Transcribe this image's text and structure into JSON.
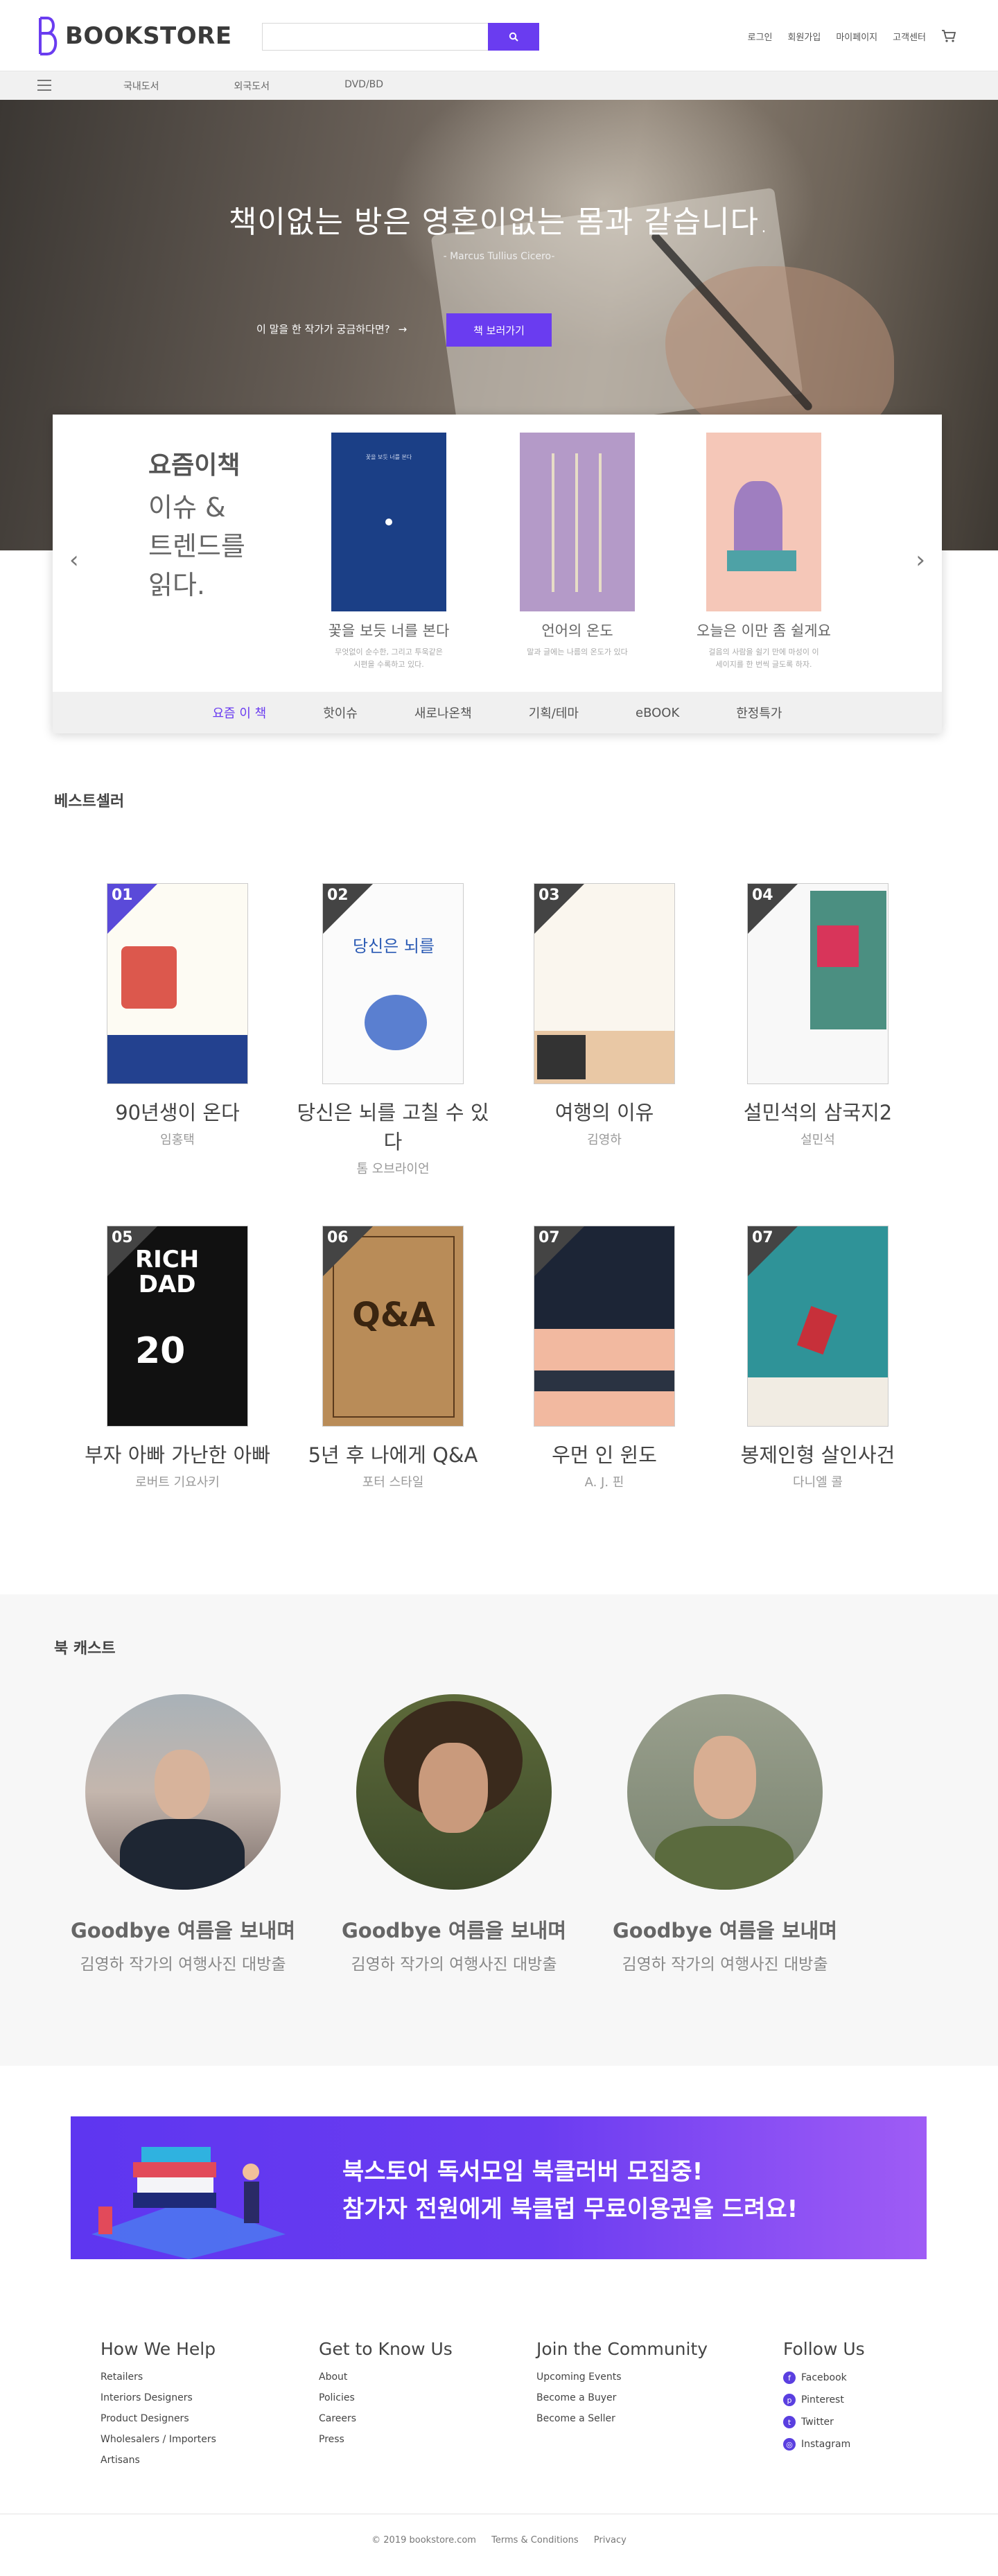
{
  "header": {
    "logo_text": "BOOKSTORE",
    "search_placeholder": "",
    "links": [
      "로그인",
      "회원가입",
      "마이페이지",
      "고객센터"
    ]
  },
  "categories": [
    "국내도서",
    "외국도서",
    "DVD/BD"
  ],
  "hero": {
    "title": "책이없는 방은 영혼이없는 몸과 같습니다.",
    "subtitle": "- Marcus Tullius Cicero-",
    "question": "이 말을 한 작가가 궁금하다면?",
    "button": "책 보러가기"
  },
  "recent": {
    "heading": "요즘이책",
    "subheading": [
      "이슈 &",
      "트렌드를",
      "읽다."
    ],
    "books": [
      {
        "title": "꽃을 보듯 너를 본다",
        "desc": "무엇없이 순수한, 그리고 투욱같은\n시편을 수록하고 있다."
      },
      {
        "title": "언어의 온도",
        "desc": "말과 글에는 나름의 온도가 있다"
      },
      {
        "title": "오늘은 이만 좀 쉴게요",
        "desc": "걸음의 사람을 쉴기 만에 마성이 이\n 세이지를 한 번씩 글도록 하자."
      }
    ],
    "tabs": [
      "요즘 이 책",
      "핫이슈",
      "새로나온책",
      "기획/테마",
      "eBOOK",
      "한정특가"
    ]
  },
  "bestseller": {
    "title": "베스트셀러",
    "books": [
      {
        "rank": "01",
        "title": "90년생이 온다",
        "author": "임홍택"
      },
      {
        "rank": "02",
        "title": "당신은 뇌를 고칠 수 있다",
        "author": "톰 오브라이언"
      },
      {
        "rank": "03",
        "title": "여행의 이유",
        "author": "김영하"
      },
      {
        "rank": "04",
        "title": "설민석의 삼국지2",
        "author": "설민석"
      },
      {
        "rank": "05",
        "title": "부자 아빠 가난한 아빠",
        "author": "로버트 기요사키"
      },
      {
        "rank": "06",
        "title": "5년 후 나에게 Q&A",
        "author": "포터 스타일"
      },
      {
        "rank": "07",
        "title": "우먼 인 윈도",
        "author": "A. J. 핀"
      },
      {
        "rank": "07",
        "title": "봉제인형 살인사건",
        "author": "다니엘 콜"
      }
    ]
  },
  "podcast": {
    "title": "북 캐스트",
    "items": [
      {
        "title": "Goodbye 여름을 보내며",
        "sub": "김영하 작가의 여행사진 대방출"
      },
      {
        "title": "Goodbye 여름을 보내며",
        "sub": "김영하 작가의 여행사진 대방출"
      },
      {
        "title": "Goodbye 여름을 보내며",
        "sub": "김영하 작가의 여행사진 대방출"
      }
    ]
  },
  "banner": {
    "line1": "북스토어 독서모임 북클러버 모집중!",
    "line2": "참가자 전원에게 북클럽 무료이용권을 드려요!"
  },
  "footer": {
    "columns": [
      {
        "title": "How We Help",
        "items": [
          "Retailers",
          "Interiors Designers",
          "Product Designers",
          "Wholesalers / Importers",
          "Artisans"
        ]
      },
      {
        "title": "Get to Know Us",
        "items": [
          "About",
          "Policies",
          "Careers",
          "Press"
        ]
      },
      {
        "title": "Join the Community",
        "items": [
          "Upcoming Events",
          "Become a Buyer",
          "Become a Seller"
        ]
      },
      {
        "title": "Follow Us",
        "items": [
          "Facebook",
          "Pinterest",
          "Twitter",
          "Instagram"
        ]
      }
    ],
    "bottom": [
      "© 2019 bookstore.com",
      "Terms & Conditions",
      "Privacy"
    ]
  },
  "colors": {
    "accent": "#6a3cf0"
  }
}
